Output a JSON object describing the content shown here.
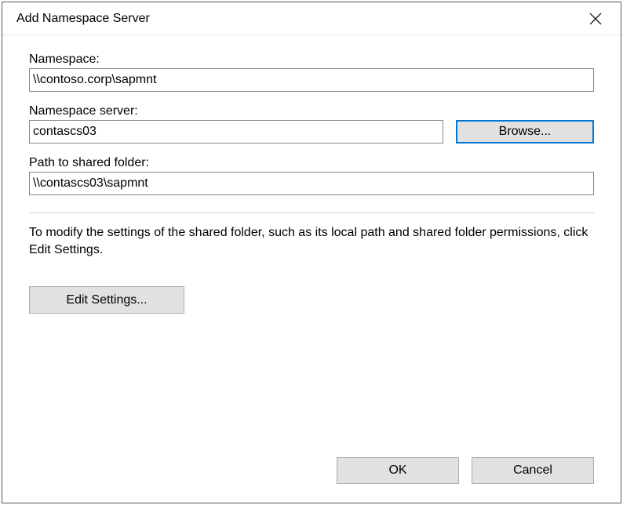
{
  "title": "Add Namespace Server",
  "labels": {
    "namespace": "Namespace:",
    "namespace_server": "Namespace server:",
    "shared_path": "Path to shared folder:"
  },
  "values": {
    "namespace": "\\\\contoso.corp\\sapmnt",
    "namespace_server": "contascs03",
    "shared_path": "\\\\contascs03\\sapmnt"
  },
  "help_text": "To modify the settings of the shared folder, such as its local path and shared folder permissions, click Edit Settings.",
  "buttons": {
    "browse": "Browse...",
    "edit_settings": "Edit Settings...",
    "ok": "OK",
    "cancel": "Cancel"
  }
}
